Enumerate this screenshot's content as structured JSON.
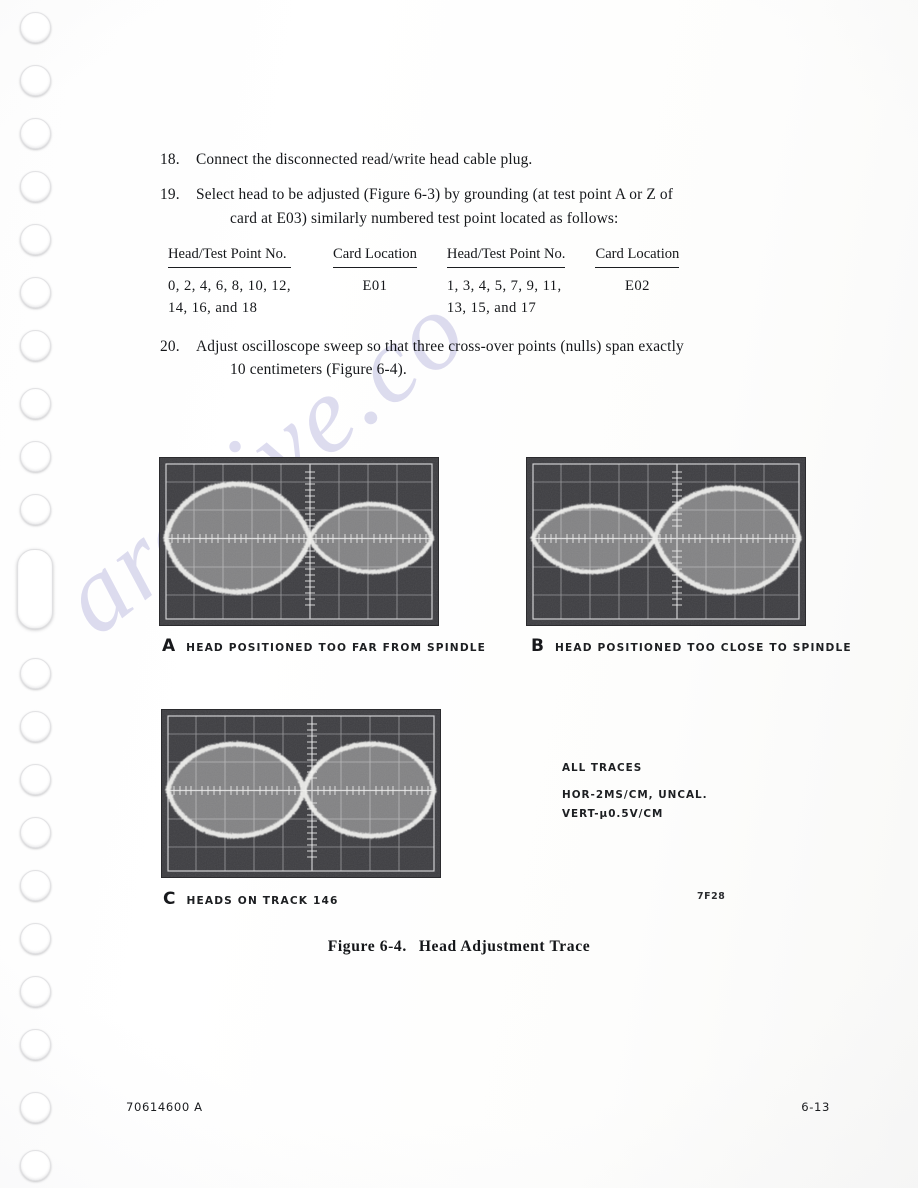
{
  "document": {
    "steps": [
      {
        "number": "18.",
        "lines": [
          "Connect the disconnected read/write head cable plug."
        ]
      },
      {
        "number": "19.",
        "lines": [
          "Select head to be adjusted (Figure 6-3) by grounding (at test point A or Z of",
          "card at E03) similarly numbered test point located as follows:"
        ]
      },
      {
        "number": "20.",
        "lines": [
          "Adjust oscilloscope sweep so that three cross-over points (nulls) span exactly",
          "10 centimeters (Figure 6-4)."
        ]
      }
    ],
    "test_point_table": {
      "headers": [
        "Head/Test Point No.",
        "Card Location",
        "Head/Test Point No.",
        "Card Location"
      ],
      "rows": [
        {
          "head_points_line1": "0, 2, 4, 6, 8, 10, 12,",
          "head_points_line2": "14, 16, and 18",
          "card_location": "E01",
          "head_points2_line1": "1, 3, 4, 5, 7, 9, 11,",
          "head_points2_line2": "13, 15, and 17",
          "card_location2": "E02"
        }
      ]
    }
  },
  "figure": {
    "title_number": "Figure 6-4.",
    "title_text": "Head Adjustment Trace",
    "photo_reference": "7F28",
    "traces": [
      {
        "letter": "A",
        "caption": "HEAD POSITIONED TOO FAR FROM SPINDLE",
        "condition": "left-lobe-larger"
      },
      {
        "letter": "B",
        "caption": "HEAD POSITIONED TOO CLOSE TO SPINDLE",
        "condition": "right-lobe-larger"
      },
      {
        "letter": "C",
        "caption": "HEADS ON TRACK 146",
        "condition": "balanced"
      }
    ],
    "settings": {
      "heading": "ALL TRACES",
      "horizontal": "HOR-2MS/CM, UNCAL.",
      "vertical": "VERT-μ0.5V/CM"
    }
  },
  "footer": {
    "document_number": "70614600 A",
    "page_number": "6-13"
  },
  "watermark": {
    "text": "archive.co"
  },
  "colors": {
    "paper": "#fefefe",
    "ink": "#15171a",
    "scope_background": "#3c3c40",
    "scope_graticule": "#d8d8da",
    "scope_trace": "#f2f2f0",
    "watermark": "#5452b0"
  }
}
